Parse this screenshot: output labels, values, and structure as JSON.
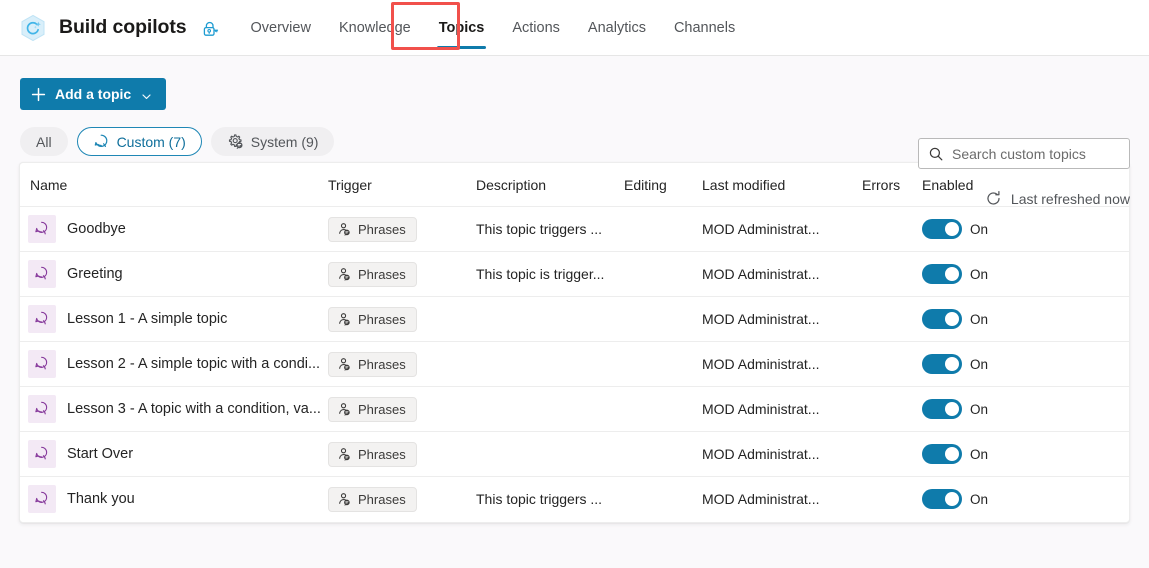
{
  "header": {
    "brand_title": "Build copilots",
    "logo_icon": "copilot-hexagon-icon",
    "lock_icon": "lock-key-icon",
    "tabs": [
      {
        "label": "Overview",
        "selected": false
      },
      {
        "label": "Knowledge",
        "selected": false
      },
      {
        "label": "Topics",
        "selected": true
      },
      {
        "label": "Actions",
        "selected": false
      },
      {
        "label": "Analytics",
        "selected": false
      },
      {
        "label": "Channels",
        "selected": false
      }
    ],
    "annotation_color": "#f1504b",
    "accent_color": "#0f7bab"
  },
  "toolbar": {
    "add_topic_label": "Add a topic",
    "add_topic_icons": [
      "plus-icon",
      "chevron-down-icon"
    ],
    "filters": [
      {
        "label": "All",
        "icon": null,
        "selected": false
      },
      {
        "label": "Custom (7)",
        "icon": "chat-bubble-icon",
        "selected": true
      },
      {
        "label": "System (9)",
        "icon": "gear-chat-icon",
        "selected": false
      }
    ],
    "search": {
      "placeholder": "Search custom topics",
      "value": "",
      "icon": "search-icon"
    },
    "refresh": {
      "label": "Last refreshed now",
      "icon": "refresh-icon"
    }
  },
  "table": {
    "columns": [
      "Name",
      "Trigger",
      "Description",
      "Editing",
      "Last modified",
      "Errors",
      "Enabled"
    ],
    "rows": [
      {
        "icon": "topic-chat-icon",
        "name": "Goodbye",
        "trigger": "Phrases",
        "trigger_icon": "phrases-person-icon",
        "description": "This topic triggers ...",
        "editing": "",
        "last_modified": "MOD Administrat...",
        "errors": "",
        "enabled": true,
        "enabled_label": "On"
      },
      {
        "icon": "topic-chat-icon",
        "name": "Greeting",
        "trigger": "Phrases",
        "trigger_icon": "phrases-person-icon",
        "description": "This topic is trigger...",
        "editing": "",
        "last_modified": "MOD Administrat...",
        "errors": "",
        "enabled": true,
        "enabled_label": "On"
      },
      {
        "icon": "topic-chat-icon",
        "name": "Lesson 1 - A simple topic",
        "trigger": "Phrases",
        "trigger_icon": "phrases-person-icon",
        "description": "",
        "editing": "",
        "last_modified": "MOD Administrat...",
        "errors": "",
        "enabled": true,
        "enabled_label": "On"
      },
      {
        "icon": "topic-chat-icon",
        "name": "Lesson 2 - A simple topic with a condi...",
        "trigger": "Phrases",
        "trigger_icon": "phrases-person-icon",
        "description": "",
        "editing": "",
        "last_modified": "MOD Administrat...",
        "errors": "",
        "enabled": true,
        "enabled_label": "On"
      },
      {
        "icon": "topic-chat-icon",
        "name": "Lesson 3 - A topic with a condition, va...",
        "trigger": "Phrases",
        "trigger_icon": "phrases-person-icon",
        "description": "",
        "editing": "",
        "last_modified": "MOD Administrat...",
        "errors": "",
        "enabled": true,
        "enabled_label": "On"
      },
      {
        "icon": "topic-chat-icon",
        "name": "Start Over",
        "trigger": "Phrases",
        "trigger_icon": "phrases-person-icon",
        "description": "",
        "editing": "",
        "last_modified": "MOD Administrat...",
        "errors": "",
        "enabled": true,
        "enabled_label": "On"
      },
      {
        "icon": "topic-chat-icon",
        "name": "Thank you",
        "trigger": "Phrases",
        "trigger_icon": "phrases-person-icon",
        "description": "This topic triggers ...",
        "editing": "",
        "last_modified": "MOD Administrat...",
        "errors": "",
        "enabled": true,
        "enabled_label": "On"
      }
    ]
  }
}
